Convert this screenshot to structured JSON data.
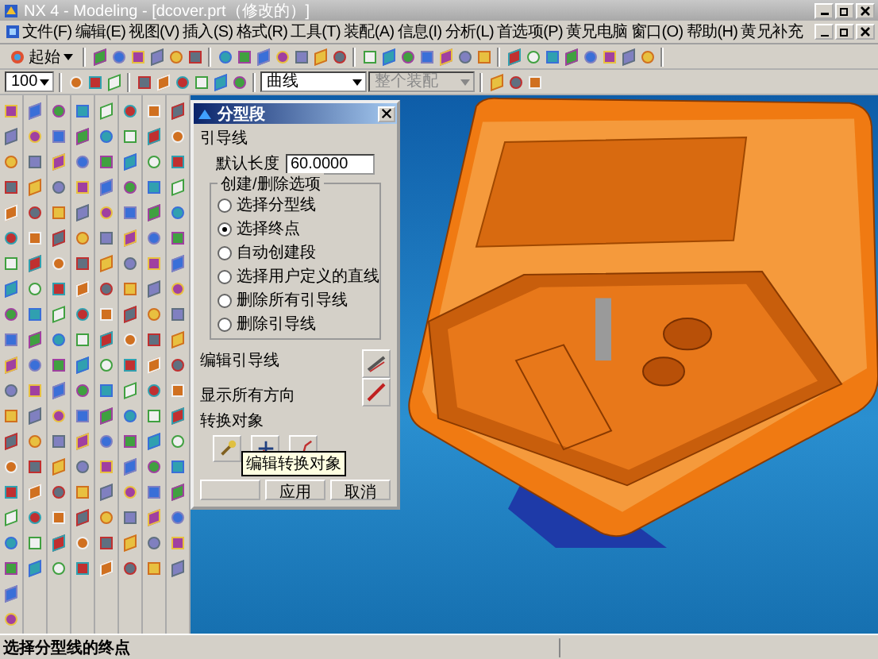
{
  "window": {
    "title": "NX 4 - Modeling - [dcover.prt（修改的）]"
  },
  "menu": [
    "文件(F)",
    "编辑(E)",
    "视图(V)",
    "插入(S)",
    "格式(R)",
    "工具(T)",
    "装配(A)",
    "信息(I)",
    "分析(L)",
    "首选项(P)",
    "黄兄电脑",
    "窗口(O)",
    "帮助(H)",
    "黄兄补充"
  ],
  "toolbar": {
    "start_label": "起始",
    "zoom": "100",
    "curve_filter": "曲线",
    "assembly_filter": {
      "value": "整个装配",
      "disabled": true
    }
  },
  "dialog": {
    "title": "分型段",
    "section": "引导线",
    "length_label": "默认长度",
    "length_value": "60.0000",
    "group_title": "创建/删除选项",
    "options": [
      {
        "label": "选择分型线",
        "selected": false
      },
      {
        "label": "选择终点",
        "selected": true
      },
      {
        "label": "自动创建段",
        "selected": false
      },
      {
        "label": "选择用户定义的直线",
        "selected": false
      },
      {
        "label": "删除所有引导线",
        "selected": false
      },
      {
        "label": "删除引导线",
        "selected": false
      }
    ],
    "edit_label": "编辑引导线",
    "show_label": "显示所有方向",
    "convert_label": "转换对象",
    "tooltip": "编辑转换对象",
    "buttons": [
      "应用",
      "取消"
    ]
  },
  "status_bar": {
    "prompt": "选择分型线的终点"
  }
}
